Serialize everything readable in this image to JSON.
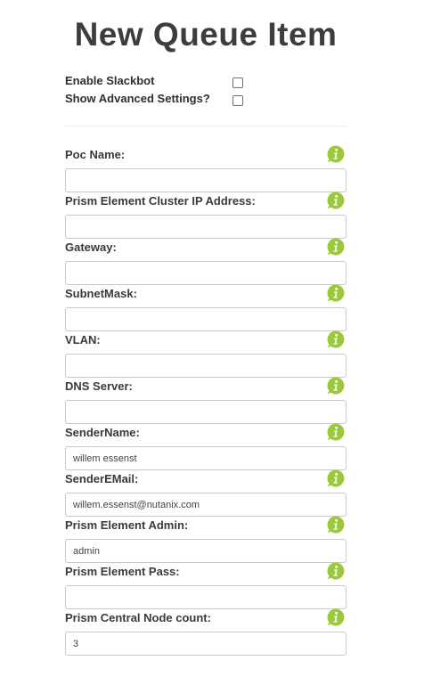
{
  "page": {
    "title": "New Queue Item"
  },
  "checkboxes": [
    {
      "label": "Enable Slackbot",
      "checked": false
    },
    {
      "label": "Show Advanced Settings?",
      "checked": false
    }
  ],
  "fields": [
    {
      "label": "Poc Name:",
      "value": ""
    },
    {
      "label": "Prism Element Cluster IP Address:",
      "value": ""
    },
    {
      "label": "Gateway:",
      "value": ""
    },
    {
      "label": "SubnetMask:",
      "value": ""
    },
    {
      "label": "VLAN:",
      "value": ""
    },
    {
      "label": "DNS Server:",
      "value": ""
    },
    {
      "label": "SenderName:",
      "value": "willem essenst"
    },
    {
      "label": "SenderEMail:",
      "value": "willem.essenst@nutanix.com"
    },
    {
      "label": "Prism Element Admin:",
      "value": "admin"
    },
    {
      "label": "Prism Element Pass:",
      "value": ""
    },
    {
      "label": "Prism Central Node count:",
      "value": "3"
    }
  ],
  "icons": {
    "info": "info-icon"
  },
  "colors": {
    "info_icon": "#9cc93a",
    "title": "#3d3d3d"
  }
}
